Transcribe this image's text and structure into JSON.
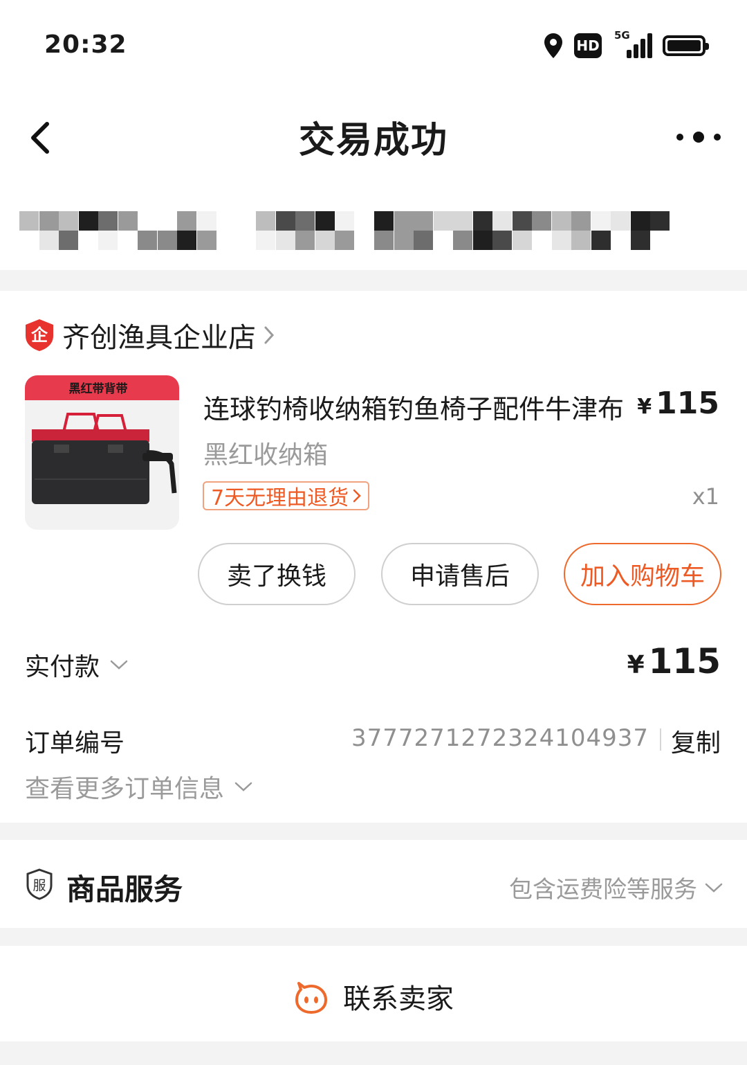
{
  "status_bar": {
    "time": "20:32",
    "hd_label": "HD",
    "network_label": "5G",
    "icons": [
      "location-icon",
      "hd-icon",
      "signal-5g-icon",
      "battery-icon"
    ]
  },
  "nav": {
    "title": "交易成功",
    "back_icon": "chevron-left-icon",
    "more_icon": "more-dots-icon"
  },
  "colors": {
    "accent": "#ee5a24",
    "accent_border": "#ee6a2c",
    "muted_text": "#9a9a9a",
    "page_bg": "#f3f3f3",
    "shop_badge": "#e8322d"
  },
  "order": {
    "shop_name": "齐创渔具企业店",
    "shop_badge_char": "企",
    "product": {
      "title": "连球钓椅收纳箱钓鱼椅子配件牛津布",
      "price_symbol": "¥",
      "price": "115",
      "sku": "黑红收纳箱",
      "return_policy": "7天无理由退货",
      "quantity": "x1",
      "image_banner": "黑红带背带"
    },
    "actions": {
      "sell": "卖了换钱",
      "after_sale": "申请售后",
      "add_to_cart": "加入购物车"
    },
    "paid_label": "实付款",
    "paid_symbol": "¥",
    "paid_amount": "115",
    "order_no_label": "订单编号",
    "order_no": "3777271272324104937",
    "copy_label": "复制",
    "more_info_label": "查看更多订单信息"
  },
  "service": {
    "icon_char": "服",
    "title": "商品服务",
    "desc": "包含运费险等服务"
  },
  "contact": {
    "label": "联系卖家"
  }
}
